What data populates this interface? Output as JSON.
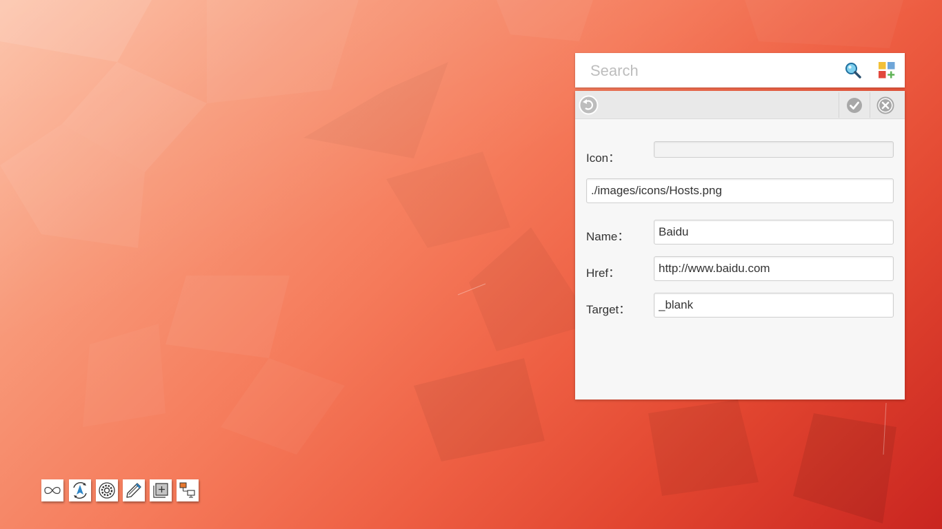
{
  "search": {
    "placeholder": "Search",
    "search_icon": "magnifier-icon",
    "apps_icon": "add-app-grid-icon"
  },
  "editor": {
    "toolbar": {
      "back_icon": "undo-icon",
      "confirm_icon": "check-icon",
      "close_icon": "close-icon"
    },
    "icon_label": "Icon：",
    "icon_path": "./images/icons/Hosts.png",
    "name_label": "Name：",
    "name_value": "Baidu",
    "href_label": "Href：",
    "href_value": "http://www.baidu.com",
    "target_label": "Target：",
    "target_value": "_blank"
  },
  "dock": {
    "items": [
      {
        "icon": "infinity-icon"
      },
      {
        "icon": "compass-icon"
      },
      {
        "icon": "settings-gear-icon"
      },
      {
        "icon": "pencil-icon"
      },
      {
        "icon": "add-window-icon"
      },
      {
        "icon": "network-display-icon"
      }
    ]
  },
  "colors": {
    "panel_bg": "#f7f7f7",
    "toolbar_bg": "#e9e9e9",
    "accent_blue": "#2f86c7",
    "wallpaper_light": "#fcbfa4",
    "wallpaper_dark": "#c92520"
  }
}
